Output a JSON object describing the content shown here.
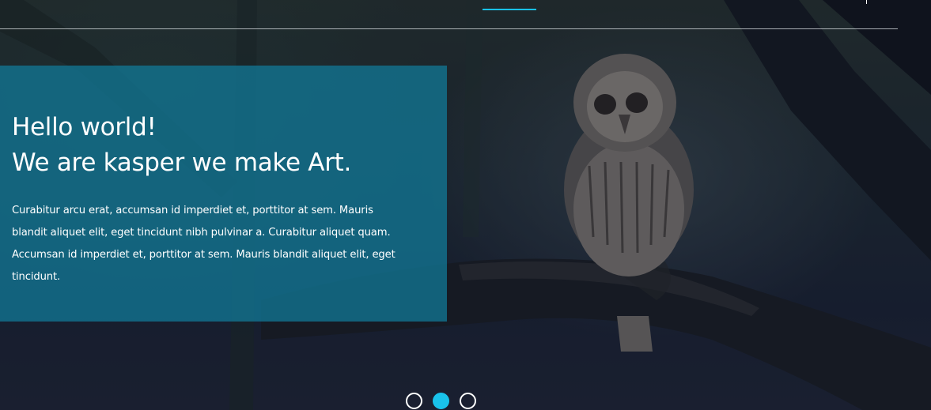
{
  "hero": {
    "headline_line1": "Hello world!",
    "headline_line2": "We are kasper we make Art.",
    "description": "Curabitur arcu erat, accumsan id imperdiet et, porttitor at sem. Mauris blandit aliquet elit, eget tincidunt nibh pulvinar a. Curabitur aliquet quam. Accumsan id imperdiet et, porttitor at sem. Mauris blandit aliquet elit, eget tincidunt."
  },
  "slider": {
    "active_index": 2,
    "total": 3
  },
  "colors": {
    "accent": "#19c2eb",
    "overlay": "#127693"
  }
}
